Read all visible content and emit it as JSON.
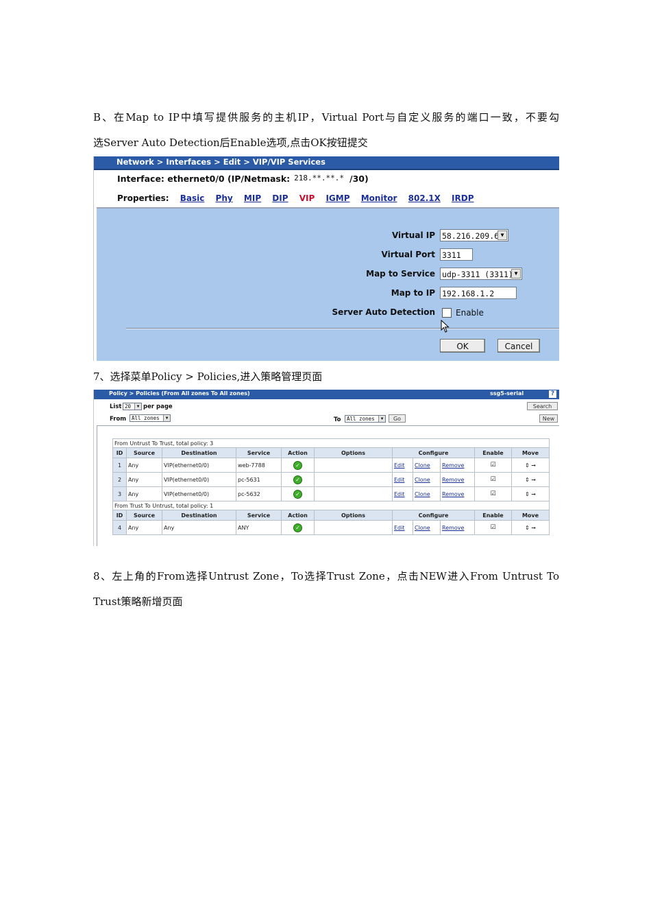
{
  "paragraphs": {
    "p1_line1": "B、在Map to IP中填写提供服务的主机IP，Virtual Port与自定义服务的端口一致，不要勾",
    "p1_line2": "选Server Auto Detection后Enable选项,点击OK按钮提交",
    "p2_line1": "7、选择菜单Policy > Policies,进入策略管理页面",
    "p3_line1": "8、左上角的From选择Untrust Zone，To选择Trust Zone，点击NEW进入From Untrust To",
    "p3_line2": "Trust策略新增页面"
  },
  "vip_screen": {
    "breadcrumb": "Network > Interfaces > Edit > VIP/VIP Services",
    "interface_prefix": "Interface: ethernet0/0 (IP/Netmask:",
    "interface_ip": "218.**.**.*",
    "interface_suffix": "/30)",
    "properties_label": "Properties:",
    "tabs": [
      "Basic",
      "Phy",
      "MIP",
      "DIP",
      "VIP",
      "IGMP",
      "Monitor",
      "802.1X",
      "IRDP"
    ],
    "fields": {
      "virtual_ip_label": "Virtual IP",
      "virtual_ip_value": "58.216.209.6",
      "virtual_port_label": "Virtual Port",
      "virtual_port_value": "3311",
      "map_service_label": "Map to Service",
      "map_service_value": "udp-3311 (3311)",
      "map_ip_label": "Map to IP",
      "map_ip_value": "192.168.1.2",
      "auto_detect_label": "Server Auto Detection",
      "auto_detect_option": "Enable"
    },
    "buttons": {
      "ok": "OK",
      "cancel": "Cancel"
    }
  },
  "policy_screen": {
    "breadcrumb": "Policy > Policies (From All zones To All zones)",
    "device": "ssg5-serial",
    "help": "?",
    "list_label": "List",
    "list_value": "20",
    "per_page": "per page",
    "from_label": "From",
    "from_value": "All zones",
    "to_label": "To",
    "to_value": "All zones",
    "go": "Go",
    "search": "Search",
    "new": "New",
    "headers": [
      "ID",
      "Source",
      "Destination",
      "Service",
      "Action",
      "Options",
      "Configure",
      "Enable",
      "Move"
    ],
    "groups": [
      {
        "title": "From Untrust To Trust, total policy: 3",
        "rows": [
          {
            "id": "1",
            "source": "Any",
            "destination": "VIP(ethernet0/0)",
            "service": "web-7788",
            "edit": "Edit",
            "clone": "Clone",
            "remove": "Remove"
          },
          {
            "id": "2",
            "source": "Any",
            "destination": "VIP(ethernet0/0)",
            "service": "pc-5631",
            "edit": "Edit",
            "clone": "Clone",
            "remove": "Remove"
          },
          {
            "id": "3",
            "source": "Any",
            "destination": "VIP(ethernet0/0)",
            "service": "pc-5632",
            "edit": "Edit",
            "clone": "Clone",
            "remove": "Remove"
          }
        ]
      },
      {
        "title": "From Trust To Untrust, total policy: 1",
        "rows": [
          {
            "id": "4",
            "source": "Any",
            "destination": "Any",
            "service": "ANY",
            "edit": "Edit",
            "clone": "Clone",
            "remove": "Remove"
          }
        ]
      }
    ]
  }
}
